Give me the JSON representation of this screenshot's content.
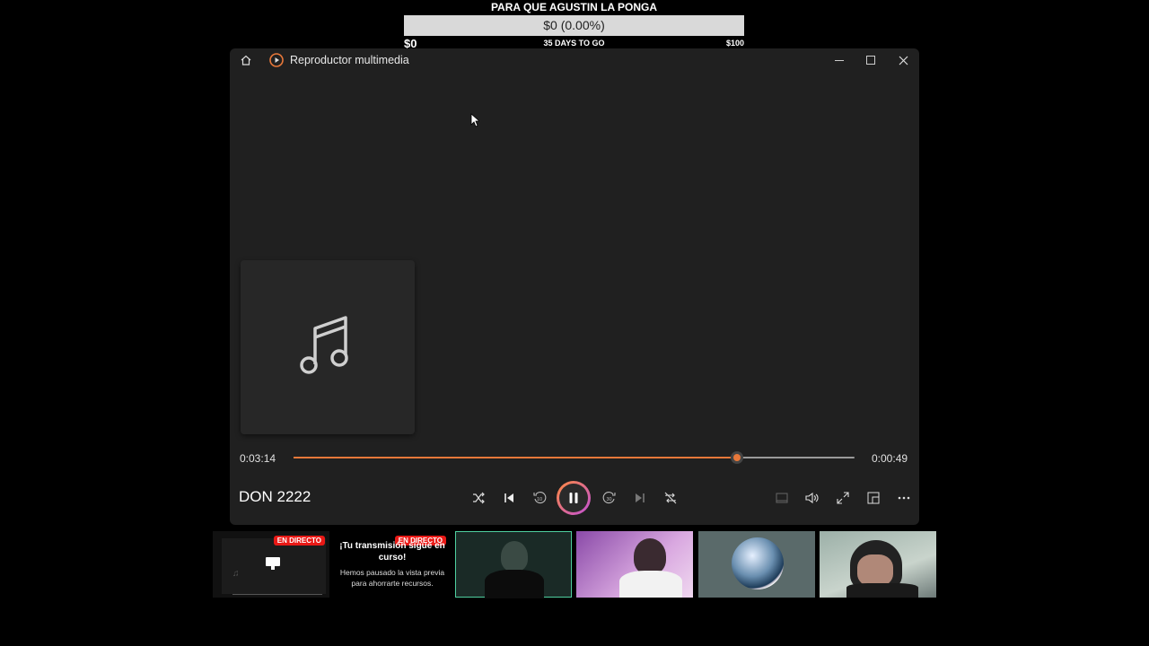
{
  "goal": {
    "title": "PARA QUE AGUSTIN LA PONGA",
    "amount_text": "$0 (0.00%)",
    "progress_fraction": 0.0,
    "min_label": "$0",
    "days_label": "35 DAYS TO GO",
    "max_label": "$100"
  },
  "player": {
    "app_title": "Reproductor multimedia",
    "elapsed": "0:03:14",
    "remaining": "0:00:49",
    "progress_fraction": 0.791,
    "track_title": "DON 2222",
    "accent_color": "#e8783a",
    "icons": [
      "home-icon",
      "media-player-icon",
      "music-note-icon",
      "shuffle-icon",
      "previous-icon",
      "rewind-10-icon",
      "pause-icon",
      "forward-30-icon",
      "next-icon",
      "repeat-off-icon",
      "mini-player-icon",
      "volume-icon",
      "fullscreen-icon",
      "cast-icon",
      "more-icon"
    ]
  },
  "previews": {
    "live_badge": "EN DIRECTO",
    "paused_title": "¡Tu transmisión sigue en curso!",
    "paused_text": "Hemos pausado la vista previa para ahorrarte recursos.",
    "live_color": "#e91916"
  }
}
